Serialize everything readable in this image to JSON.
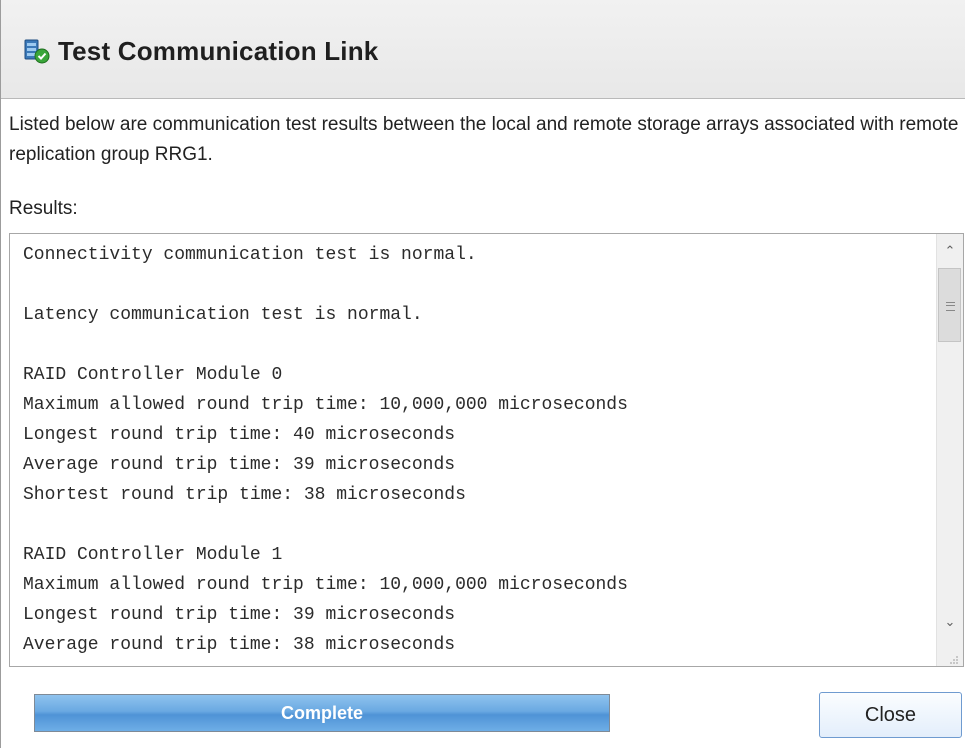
{
  "dialog": {
    "title": "Test Communication Link",
    "title_icon": "storage-array-check-icon",
    "description": "Listed below are communication test results between the local and remote storage arrays associated with remote replication group RRG1.",
    "results_label": "Results:"
  },
  "results": {
    "lines": [
      "Connectivity communication test is normal.",
      "",
      "Latency communication test is normal.",
      "",
      "RAID Controller Module 0",
      "Maximum allowed round trip time: 10,000,000 microseconds",
      "Longest round trip time: 40 microseconds",
      "Average round trip time: 39 microseconds",
      "Shortest round trip time: 38 microseconds",
      "",
      "RAID Controller Module 1",
      "Maximum allowed round trip time: 10,000,000 microseconds",
      "Longest round trip time: 39 microseconds",
      "Average round trip time: 38 microseconds"
    ]
  },
  "progress": {
    "label": "Complete",
    "fraction": 1.0
  },
  "buttons": {
    "close_label": "Close"
  },
  "colors": {
    "progress_fill": "#5b9fdf",
    "button_border": "#6f9bd0"
  }
}
